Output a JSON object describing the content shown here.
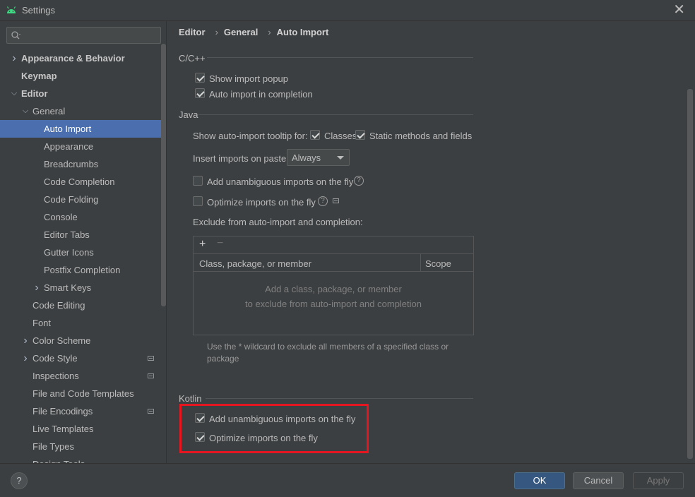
{
  "window": {
    "title": "Settings"
  },
  "search": {
    "placeholder": ""
  },
  "tree": [
    {
      "label": "Appearance & Behavior",
      "bold": true,
      "expandable": true
    },
    {
      "label": "Keymap",
      "bold": true
    },
    {
      "label": "Editor",
      "bold": true,
      "expanded": true
    },
    {
      "label": "General",
      "expanded": true
    },
    {
      "label": "Auto Import",
      "selected": true
    },
    {
      "label": "Appearance"
    },
    {
      "label": "Breadcrumbs"
    },
    {
      "label": "Code Completion"
    },
    {
      "label": "Code Folding"
    },
    {
      "label": "Console"
    },
    {
      "label": "Editor Tabs"
    },
    {
      "label": "Gutter Icons"
    },
    {
      "label": "Postfix Completion"
    },
    {
      "label": "Smart Keys",
      "expandable": true
    },
    {
      "label": "Code Editing"
    },
    {
      "label": "Font"
    },
    {
      "label": "Color Scheme",
      "expandable": true
    },
    {
      "label": "Code Style",
      "expandable": true,
      "project_icon": true
    },
    {
      "label": "Inspections",
      "project_icon": true
    },
    {
      "label": "File and Code Templates"
    },
    {
      "label": "File Encodings",
      "project_icon": true
    },
    {
      "label": "Live Templates"
    },
    {
      "label": "File Types"
    },
    {
      "label": "Design Tools"
    }
  ],
  "breadcrumb": {
    "level1": "Editor",
    "level2": "General",
    "level3": "Auto Import"
  },
  "cpp": {
    "title": "C/C++",
    "show_import_popup": {
      "label": "Show import popup",
      "checked": true
    },
    "auto_import_completion": {
      "label": "Auto import in completion",
      "checked": true
    }
  },
  "java": {
    "title": "Java",
    "tooltip_label": "Show auto-import tooltip for:",
    "classes": {
      "label": "Classes",
      "checked": true
    },
    "static_methods": {
      "label": "Static methods and fields",
      "checked": true
    },
    "insert_on_paste_label": "Insert imports on paste:",
    "insert_on_paste_value": "Always",
    "add_unambiguous": {
      "label": "Add unambiguous imports on the fly",
      "checked": false
    },
    "optimize_imports": {
      "label": "Optimize imports on the fly",
      "checked": false
    },
    "exclude_label": "Exclude from auto-import and completion:",
    "table": {
      "col1": "Class, package, or member",
      "col2": "Scope",
      "empty_line1": "Add a class, package, or member",
      "empty_line2": "to exclude from auto-import and completion"
    },
    "note": "Use the * wildcard to exclude all members of a specified class or package"
  },
  "kotlin": {
    "title": "Kotlin",
    "add_unambiguous": {
      "label": "Add unambiguous imports on the fly",
      "checked": true
    },
    "optimize_imports": {
      "label": "Optimize imports on the fly",
      "checked": true
    }
  },
  "footer": {
    "help": "?",
    "ok": "OK",
    "cancel": "Cancel",
    "apply": "Apply"
  }
}
